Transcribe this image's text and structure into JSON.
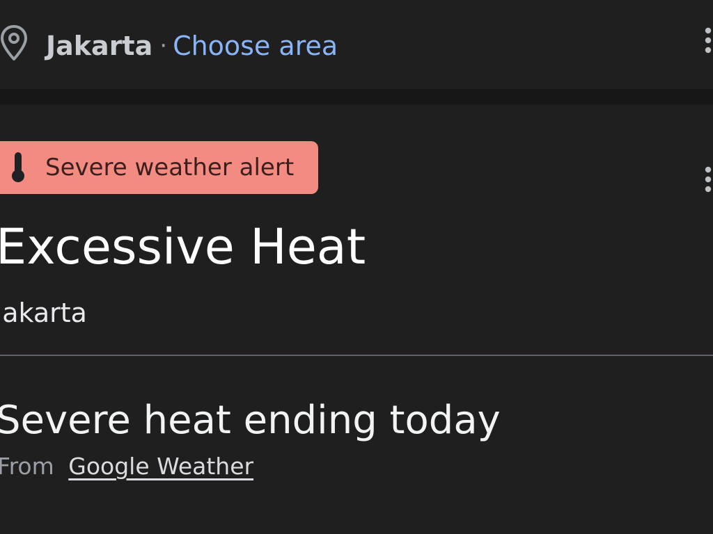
{
  "location_bar": {
    "city": "Jakarta",
    "separator": "·",
    "choose_area_label": "Choose area",
    "pin_icon": "location-pin-icon",
    "menu_icon": "more-vert-icon"
  },
  "alert_card": {
    "chip_label": "Severe weather alert",
    "chip_icon": "thermometer-icon",
    "title": "Excessive Heat",
    "area": "Jakarta",
    "headline": "Severe heat ending today",
    "source_prefix": "From",
    "source_link": "Google Weather",
    "menu_icon": "more-vert-icon"
  },
  "colors": {
    "background": "#1f1f1f",
    "band": "#171717",
    "link_blue": "#8ab4f8",
    "alert_chip": "#f28b82",
    "alert_chip_text": "#3c1f1c",
    "divider": "#5f6368"
  }
}
